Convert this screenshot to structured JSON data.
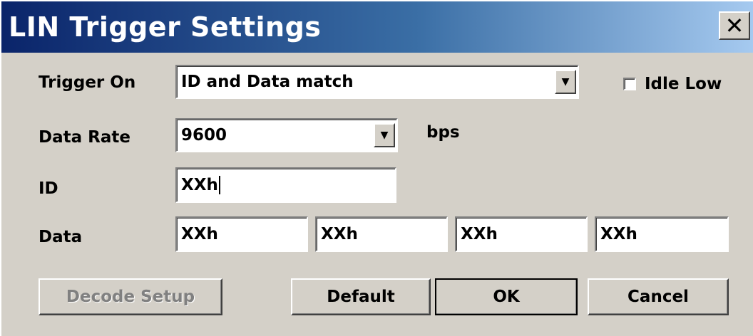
{
  "window": {
    "title": "LIN Trigger Settings",
    "close_glyph": "✕"
  },
  "trigger_on": {
    "label": "Trigger On",
    "value": "ID and Data match"
  },
  "idle_low": {
    "label": "Idle Low",
    "checked": false
  },
  "data_rate": {
    "label": "Data Rate",
    "value": "9600",
    "unit": "bps"
  },
  "id": {
    "label": "ID",
    "value": "XXh"
  },
  "data": {
    "label": "Data",
    "bytes": [
      "XXh",
      "XXh",
      "XXh",
      "XXh"
    ]
  },
  "buttons": {
    "decode_setup": "Decode Setup",
    "default": "Default",
    "ok": "OK",
    "cancel": "Cancel"
  },
  "icons": {
    "dropdown": "▼"
  }
}
